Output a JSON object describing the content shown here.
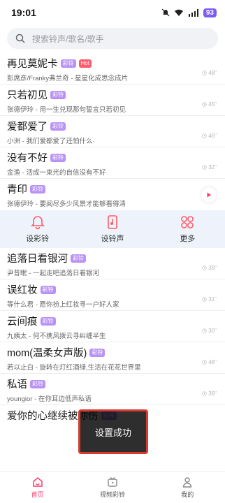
{
  "status": {
    "time": "19:01",
    "battery": "93"
  },
  "search": {
    "placeholder": "搜索铃声/歌名/歌手"
  },
  "tags": {
    "ring": "彩铃",
    "hot": "Hot"
  },
  "songs_top": [
    {
      "title": "再见莫妮卡",
      "subtitle": "彭席彦/Franky弗兰奇 - 星星化成思念成片",
      "duration": "48\"",
      "hot": true
    },
    {
      "title": "只若初见",
      "subtitle": "张德伊玲 - 用一生兑现那句誓言只若初见",
      "duration": "45\""
    },
    {
      "title": "爱都爱了",
      "subtitle": "小洲 - 我们爱都爱了还怕什么·",
      "duration": "46\""
    },
    {
      "title": "没有不好",
      "subtitle": "金渔 - 活成一束光的自信没有不好",
      "duration": "32\""
    },
    {
      "title": "青印",
      "subtitle": "张德伊玲 - 要阅尽多少风景才能够看得清"
    }
  ],
  "actions": [
    {
      "label": "设彩铃",
      "icon": "bell-icon"
    },
    {
      "label": "设铃声",
      "icon": "phone-music-icon"
    },
    {
      "label": "更多",
      "icon": "grid-icon"
    }
  ],
  "songs_bottom": [
    {
      "title": "追落日看银河",
      "subtitle": "尹昔眠 - 一起走吧追落日看银河",
      "duration": "39\""
    },
    {
      "title": "误红妆",
      "subtitle": "等什么君 - 愿你扮上红妆寻一户好人家",
      "duration": "31\""
    },
    {
      "title": "云间痕",
      "subtitle": "九姨太 - 何不携风拨云寻纠缠半生",
      "duration": "30\""
    },
    {
      "title": "mom(温柔女声版)",
      "subtitle": "若以止白 - 旋转在灯红酒绿,生活在花花世界里",
      "duration": "48\""
    },
    {
      "title": "私语",
      "subtitle": "youngior - 在你耳边低声私语",
      "duration": "39\""
    },
    {
      "title": "爱你的心继续被你伤"
    }
  ],
  "toast": {
    "message": "设置成功"
  },
  "nav": [
    {
      "label": "首页",
      "icon": "home-icon",
      "active": true
    },
    {
      "label": "视频彩铃",
      "icon": "tv-icon"
    },
    {
      "label": "我的",
      "icon": "user-icon"
    }
  ],
  "colors": {
    "accent": "#ff3b6b",
    "tag_ring": "#b893f5",
    "tag_hot": "#ff5b6a",
    "action_bg": "#eef3fb"
  }
}
